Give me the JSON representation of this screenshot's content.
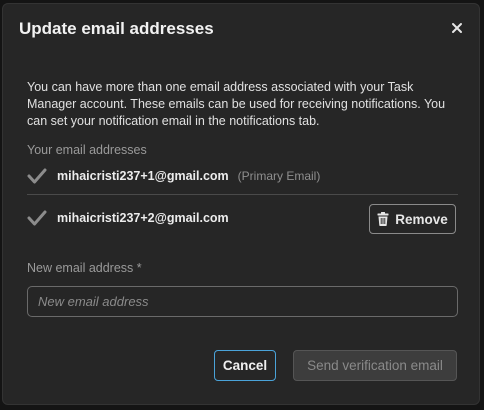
{
  "dialog": {
    "title": "Update email addresses",
    "description": "You can have more than one email address associated with your Task Manager account. These emails can be used for receiving notifications. You can set your notification email in the notifications tab.",
    "emails_section_label": "Your email addresses",
    "emails": [
      {
        "address": "mihaicristi237+1@gmail.com",
        "tag": "(Primary Email)"
      },
      {
        "address": "mihaicristi237+2@gmail.com",
        "action_label": "Remove"
      }
    ],
    "new_email": {
      "label": "New email address *",
      "placeholder": "New email address",
      "value": ""
    },
    "buttons": {
      "cancel": "Cancel",
      "send": "Send verification email"
    }
  },
  "colors": {
    "dialog_bg": "#262626",
    "focus_border": "#4aa3d9",
    "disabled_button_bg": "#3d3d3d"
  },
  "icons": {
    "close": "close-icon",
    "verified": "checkmark-icon",
    "remove": "trash-icon"
  }
}
